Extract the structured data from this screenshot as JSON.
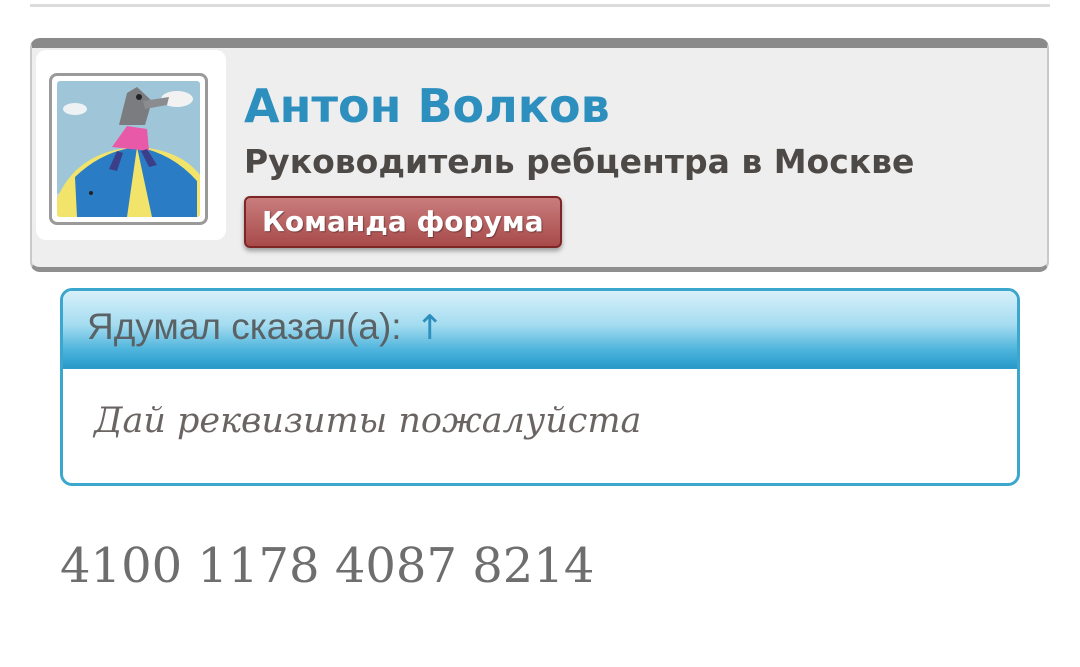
{
  "author": {
    "name": "Антон Волков",
    "title": "Руководитель ребцентра в Москве",
    "badge": "Команда форума",
    "avatar_icon": "avatar-cartoon-wolf-on-umbrella"
  },
  "quote": {
    "author_label": "Ядумал сказал(а):",
    "arrow": "↑",
    "text": "Дай реквизиты пожалуйста"
  },
  "post": {
    "text": "4100 1178 4087 8214"
  },
  "colors": {
    "name": "#2d8fbe",
    "badge": "#a84a4a",
    "quote_border": "#3ba7cc",
    "card_bg": "#eeeeee"
  }
}
